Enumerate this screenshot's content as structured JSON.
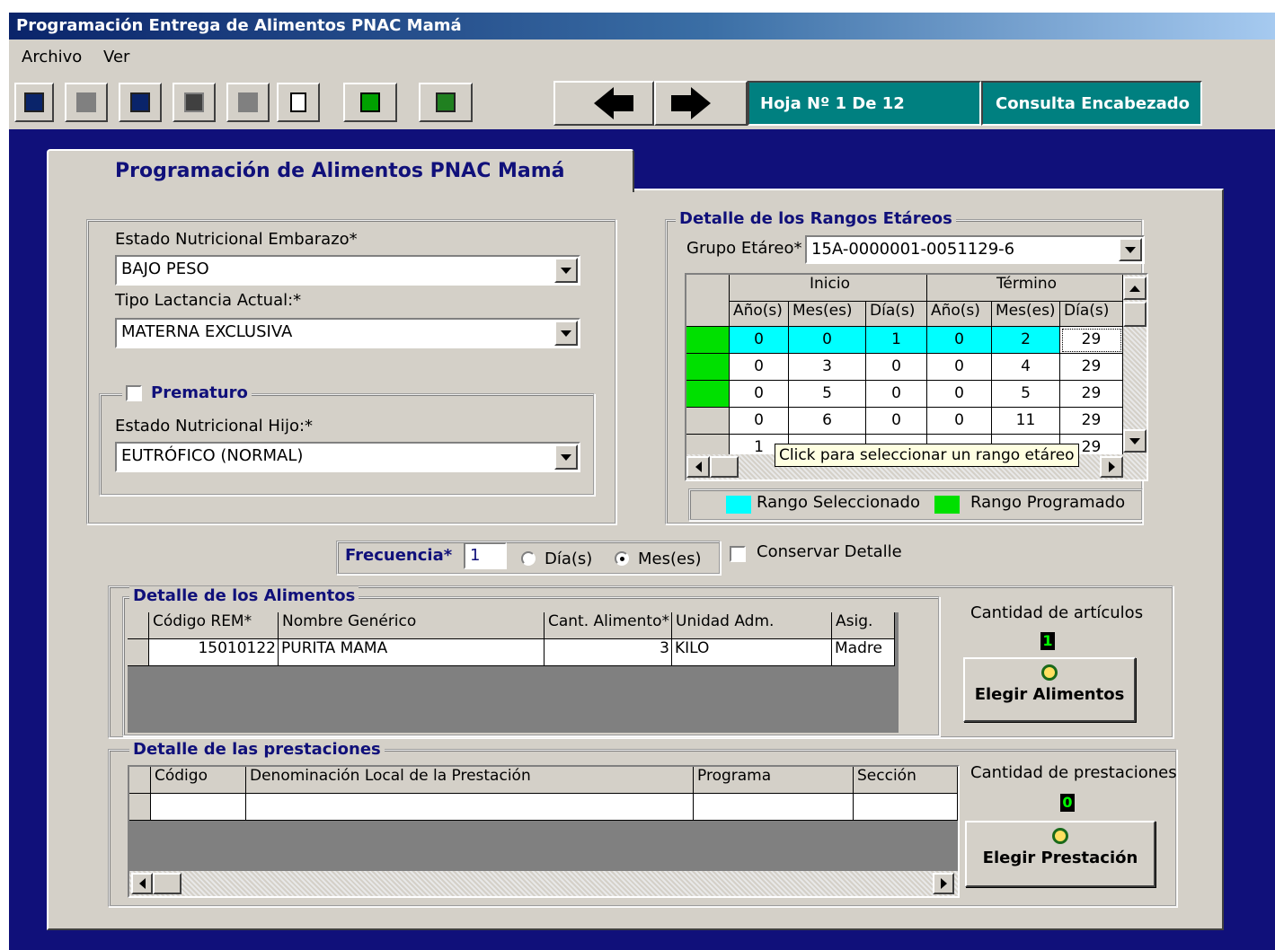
{
  "window": {
    "title": "Programación Entrega de Alimentos PNAC Mamá"
  },
  "menu": [
    "Archivo",
    "Ver"
  ],
  "toolbar": {
    "page_label": "Hoja Nº  1 De  12",
    "consulta_label": "Consulta Encabezado"
  },
  "tab": {
    "title": "Programación de Alimentos PNAC Mamá"
  },
  "form": {
    "estado_embarazo_label": "Estado Nutricional Embarazo*",
    "estado_embarazo_value": "BAJO PESO",
    "lactancia_label": "Tipo Lactancia Actual:*",
    "lactancia_value": "MATERNA EXCLUSIVA",
    "prematuro_label": "Prematuro",
    "estado_hijo_label": "Estado Nutricional Hijo:*",
    "estado_hijo_value": "EUTRÓFICO (NORMAL)"
  },
  "rangos": {
    "legend": "Detalle de los Rangos Etáreos",
    "grupo_label": "Grupo Etáreo*",
    "grupo_value": "15A-0000001-0051129-6",
    "group_headers": [
      "Inicio",
      "Término"
    ],
    "columns": [
      "Año(s)",
      "Mes(es)",
      "Día(s)",
      "Año(s)",
      "Mes(es)",
      "Día(s)"
    ],
    "rows": [
      {
        "status": "programado",
        "selected": true,
        "cells": [
          "0",
          "0",
          "1",
          "0",
          "2",
          "29"
        ]
      },
      {
        "status": "programado",
        "selected": false,
        "cells": [
          "0",
          "3",
          "0",
          "0",
          "4",
          "29"
        ]
      },
      {
        "status": "programado",
        "selected": false,
        "cells": [
          "0",
          "5",
          "0",
          "0",
          "5",
          "29"
        ]
      },
      {
        "status": "none",
        "selected": false,
        "cells": [
          "0",
          "6",
          "0",
          "0",
          "11",
          "29"
        ]
      },
      {
        "status": "none",
        "selected": false,
        "cells": [
          "1",
          "",
          "",
          "",
          "",
          "29"
        ]
      }
    ],
    "tooltip": "Click para seleccionar un rango etáreo",
    "legend_selected": "Rango Seleccionado",
    "legend_programado": "Rango Programado",
    "color_selected": "#00ffff",
    "color_programado": "#00e000"
  },
  "frecuencia": {
    "label": "Frecuencia*",
    "value": "1",
    "option_dias": "Día(s)",
    "option_meses": "Mes(es)",
    "selected": "Mes(es)",
    "conservar_label": "Conservar Detalle"
  },
  "alimentos": {
    "legend": "Detalle de los Alimentos",
    "columns": [
      "Código REM*",
      "Nombre Genérico",
      "Cant. Alimento*",
      "Unidad Adm.",
      "Asig."
    ],
    "rows": [
      [
        "15010122",
        "PURITA MAMA",
        "3",
        "KILO",
        "Madre"
      ]
    ],
    "count_label": "Cantidad de artículos",
    "count": "1",
    "button_label": "Elegir Alimentos"
  },
  "prestaciones": {
    "legend": "Detalle de las prestaciones",
    "columns": [
      "Código",
      "Denominación Local de la Prestación",
      "Programa",
      "Sección"
    ],
    "count_label": "Cantidad de prestaciones",
    "count": "0",
    "button_label": "Elegir Prestación"
  }
}
